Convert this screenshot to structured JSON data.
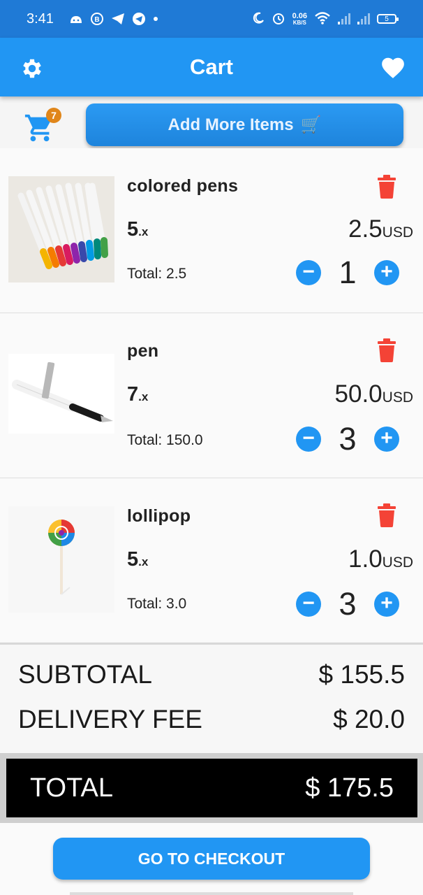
{
  "status_bar": {
    "time": "3:41",
    "net_speed_value": "0.06",
    "net_speed_unit": "KB/S",
    "battery": "5"
  },
  "app_bar": {
    "title": "Cart",
    "settings_icon": "gear-icon",
    "favorite_icon": "heart-icon"
  },
  "action_row": {
    "cart_badge": "7",
    "add_more_label": "Add More Items",
    "add_more_icon": "🛒"
  },
  "items": [
    {
      "name": "colored pens",
      "qty_number": "5",
      "qty_suffix": ".x",
      "price_value": "2.5",
      "price_currency": "USD",
      "total": "Total: 2.5",
      "quantity": "1"
    },
    {
      "name": "pen",
      "qty_number": "7",
      "qty_suffix": ".x",
      "price_value": "50.0",
      "price_currency": "USD",
      "total": "Total: 150.0",
      "quantity": "3"
    },
    {
      "name": "lollipop",
      "qty_number": "5",
      "qty_suffix": ".x",
      "price_value": "1.0",
      "price_currency": "USD",
      "total": "Total: 3.0",
      "quantity": "3"
    }
  ],
  "summary": {
    "subtotal_label": "SUBTOTAL",
    "subtotal_value": "$ 155.5",
    "delivery_label": "DELIVERY FEE",
    "delivery_value": "$ 20.0",
    "total_label": "TOTAL",
    "total_value": "$ 175.5"
  },
  "checkout": {
    "label": "GO TO CHECKOUT"
  },
  "colors": {
    "primary": "#2196f3",
    "status_bar": "#1f7ad6",
    "delete": "#f44336",
    "badge": "#e0861a"
  }
}
